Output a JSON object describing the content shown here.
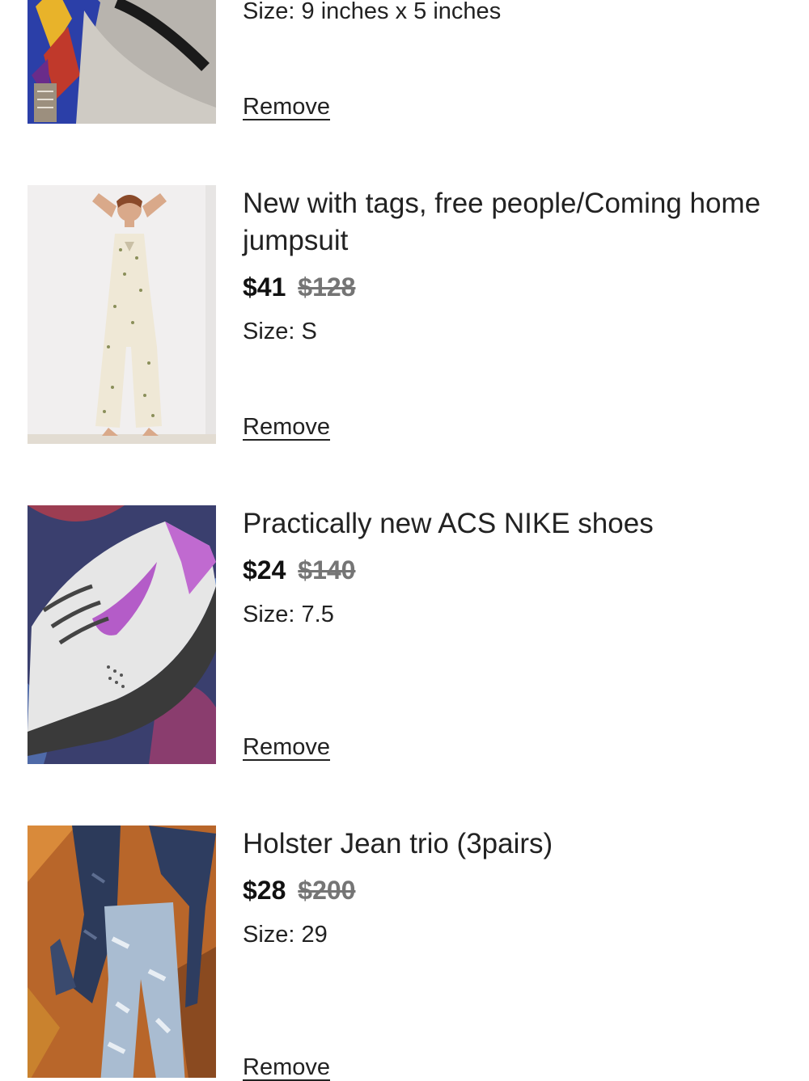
{
  "items": [
    {
      "size_label": "Size:",
      "size_value": "9 inches x 5 inches",
      "remove_label": "Remove",
      "image_icon": "bag-photo"
    },
    {
      "title": "New with tags, free people/Coming home jumpsuit",
      "price": "$41",
      "original_price": "$128",
      "size_label": "Size:",
      "size_value": "S",
      "remove_label": "Remove",
      "image_icon": "jumpsuit-photo"
    },
    {
      "title": "Practically new ACS NIKE shoes",
      "price": "$24",
      "original_price": "$140",
      "size_label": "Size:",
      "size_value": "7.5",
      "remove_label": "Remove",
      "image_icon": "shoe-photo"
    },
    {
      "title": "Holster Jean trio (3pairs)",
      "price": "$28",
      "original_price": "$200",
      "size_label": "Size:",
      "size_value": "29",
      "remove_label": "Remove",
      "image_icon": "jeans-photo"
    }
  ],
  "colors": {
    "text": "#222222",
    "strike": "#757575"
  }
}
